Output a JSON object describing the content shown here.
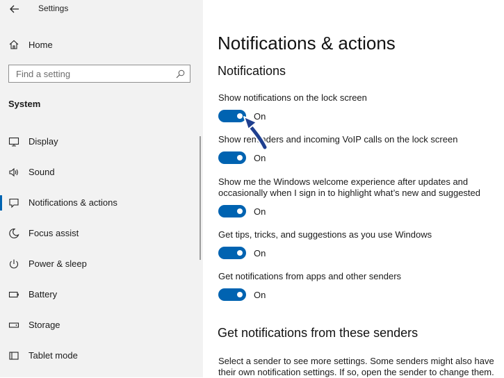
{
  "window": {
    "title": "Settings"
  },
  "sidebar": {
    "home_label": "Home",
    "search_placeholder": "Find a setting",
    "section_header": "System",
    "items": [
      {
        "label": "Display",
        "icon": "monitor-icon",
        "active": false
      },
      {
        "label": "Sound",
        "icon": "speaker-icon",
        "active": false
      },
      {
        "label": "Notifications & actions",
        "icon": "notification-icon",
        "active": true
      },
      {
        "label": "Focus assist",
        "icon": "moon-icon",
        "active": false
      },
      {
        "label": "Power & sleep",
        "icon": "power-icon",
        "active": false
      },
      {
        "label": "Battery",
        "icon": "battery-icon",
        "active": false
      },
      {
        "label": "Storage",
        "icon": "storage-icon",
        "active": false
      },
      {
        "label": "Tablet mode",
        "icon": "tablet-icon",
        "active": false
      }
    ]
  },
  "main": {
    "title": "Notifications & actions",
    "subtitle": "Notifications",
    "settings": [
      {
        "label": "Show notifications on the lock screen",
        "state": "On"
      },
      {
        "label": "Show reminders and incoming VoIP calls on the lock screen",
        "state": "On"
      },
      {
        "label": "Show me the Windows welcome experience after updates and occasionally when I sign in to highlight what’s new and suggested",
        "state": "On"
      },
      {
        "label": "Get tips, tricks, and suggestions as you use Windows",
        "state": "On"
      },
      {
        "label": "Get notifications from apps and other senders",
        "state": "On"
      }
    ],
    "senders_title": "Get notifications from these senders",
    "senders_desc": "Select a sender to see more settings. Some senders might also have their own notification settings. If so, open the sender to change them."
  },
  "colors": {
    "accent": "#0063b1",
    "sidebar_bg": "#f2f2f2",
    "annotation_arrow": "#1f3f8f"
  }
}
